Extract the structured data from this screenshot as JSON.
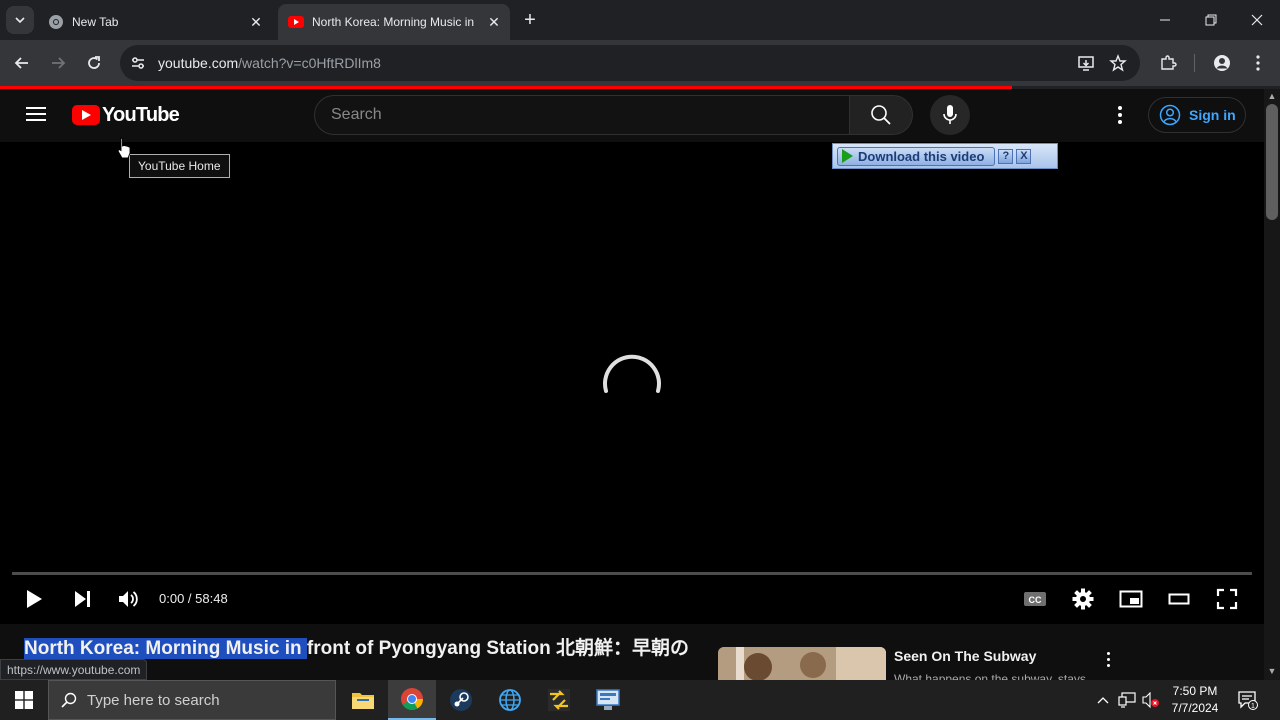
{
  "browser": {
    "tabs": [
      {
        "title": "New Tab",
        "active": false
      },
      {
        "title": "North Korea: Morning Music in",
        "active": true
      }
    ],
    "url_host": "youtube.com",
    "url_path": "/watch?v=c0HftRDlIm8",
    "status_url": "https://www.youtube.com"
  },
  "youtube": {
    "logo_text": "YouTube",
    "search_placeholder": "Search",
    "sign_in_label": "Sign in",
    "tooltip": "YouTube Home",
    "download_bar": {
      "button_label": "Download this video",
      "help_label": "?",
      "close_label": "X"
    },
    "player": {
      "time": "0:00 / 58:48",
      "progress": 0.0,
      "cc_label": "CC"
    },
    "video_title_selected": "North Korea: Morning Music in ",
    "video_title_rest": "front of Pyongyang Station 北朝鮮：早朝の",
    "recommendation": {
      "title": "Seen On The Subway",
      "subtitle": "What happens on the subway, stays..."
    }
  },
  "taskbar": {
    "search_placeholder": "Type here to search",
    "time": "7:50 PM",
    "date": "7/7/2024",
    "notification_count": "1"
  },
  "colors": {
    "youtube_red": "#ff0000",
    "link_blue": "#3ea6ff",
    "selection": "#1f4fbf"
  }
}
